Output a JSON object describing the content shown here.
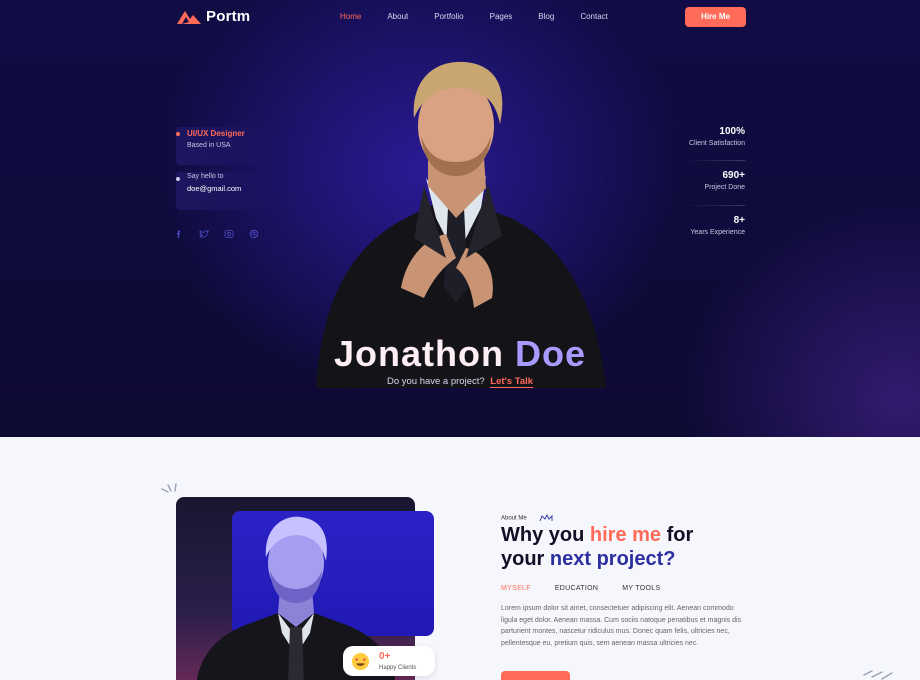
{
  "brand": {
    "name": "Portm",
    "accent": "#ff6b58",
    "dark": "#0f0b3a",
    "indigo": "#2119b5"
  },
  "nav": {
    "items": [
      {
        "label": "Home",
        "active": true
      },
      {
        "label": "About"
      },
      {
        "label": "Portfolio"
      },
      {
        "label": "Pages"
      },
      {
        "label": "Blog"
      },
      {
        "label": "Contact"
      }
    ],
    "hire_label": "Hire Me"
  },
  "hero": {
    "role": "UI/UX Designer",
    "location": "Based in USA",
    "hello": "Say hello to",
    "email": "doe@gmail.com",
    "socials": [
      "facebook-icon",
      "twitter-icon",
      "instagram-icon",
      "dribbble-icon"
    ],
    "stats": [
      {
        "value": "100%",
        "label": "Client Satisfaction"
      },
      {
        "value": "690+",
        "label": "Project Done"
      },
      {
        "value": "8+",
        "label": "Years Experience"
      }
    ],
    "first_name": "Jonathon",
    "last_name": "Doe",
    "tagline": "Do you have a project?",
    "talk": "Let's Talk"
  },
  "about": {
    "eyebrow": "About Me",
    "h_part1": "Why you ",
    "h_hire": "hire me",
    "h_part2": " for",
    "h_your": "your ",
    "h_next": "next project?",
    "tabs": [
      {
        "label": "MYSELF",
        "active": true
      },
      {
        "label": "EDUCATION"
      },
      {
        "label": "MY TOOLS"
      }
    ],
    "paragraph": "Lorem ipsum dolor sit amet, consectetuer adipiscing elit. Aenean commodo ligula eget dolor. Aenean massa. Cum sociis natoque penatibus et magnis dis parturient montes, nascetur ridiculus mus. Donec quam felis, ultricies nec, pellentesque eu, pretium quis, sem aenean massa ultricies nec.",
    "happy_count": "0+",
    "happy_label": "Happy Clients"
  }
}
